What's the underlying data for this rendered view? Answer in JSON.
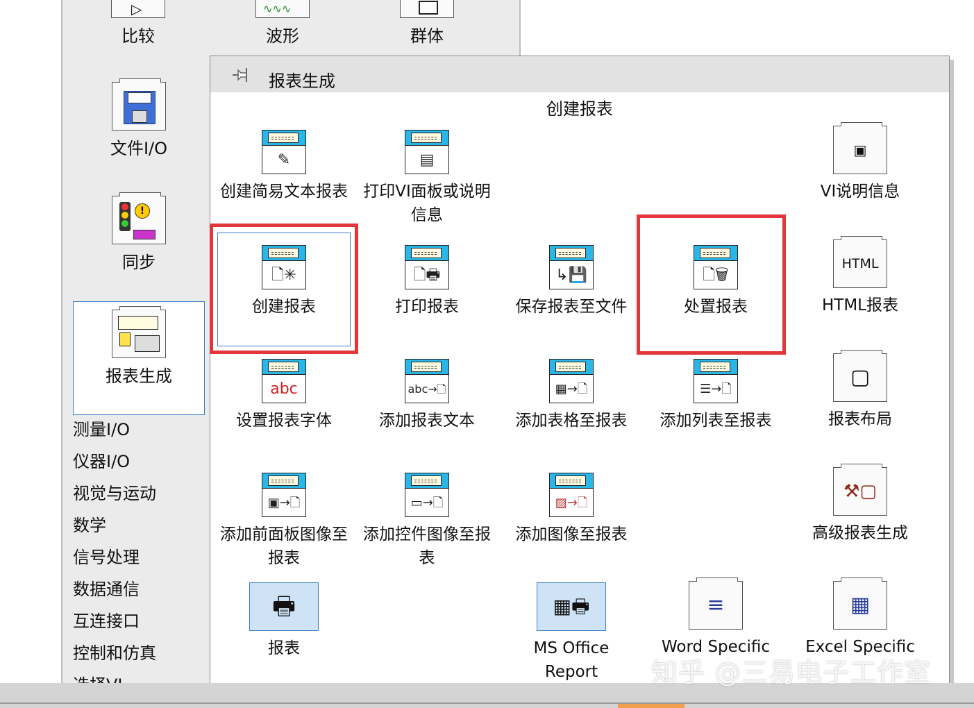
{
  "palette": {
    "top_items": [
      {
        "label": "比较",
        "icon": "compare-icon"
      },
      {
        "label": "波形",
        "icon": "waveform-icon"
      },
      {
        "label": "群体",
        "icon": "cluster-icon"
      }
    ],
    "side_items": [
      {
        "label": "文件I/O",
        "icon": "floppy-disk-icon"
      },
      {
        "label": "同步",
        "icon": "traffic-light-icon"
      },
      {
        "label": "报表生成",
        "icon": "report-printer-icon"
      }
    ],
    "categories": [
      "测量I/O",
      "仪器I/O",
      "视觉与运动",
      "数学",
      "信号处理",
      "数据通信",
      "互连接口",
      "控制和仿真",
      "选择VI..."
    ]
  },
  "submenu": {
    "title": "报表生成",
    "section": "创建报表",
    "tiles": {
      "easy_text_report": {
        "label": "创建简易文本报表",
        "glyph": "✎"
      },
      "print_panel": {
        "label": "打印VI面板或说明信息",
        "glyph": "▤"
      },
      "vi_description": {
        "label": "VI说明信息",
        "glyph": "▣"
      },
      "new_report": {
        "label": "创建报表",
        "glyph": "🗋✳"
      },
      "print_report": {
        "label": "打印报表",
        "glyph": "🗋🖶"
      },
      "save_report": {
        "label": "保存报表至文件",
        "glyph": "↳💾"
      },
      "dispose_report": {
        "label": "处置报表",
        "glyph": "🗋🗑"
      },
      "html_report": {
        "label": "HTML报表",
        "glyph": "HTML"
      },
      "set_font": {
        "label": "设置报表字体",
        "glyph": "abc"
      },
      "append_text": {
        "label": "添加报表文本",
        "glyph": "abc→🗋"
      },
      "append_table": {
        "label": "添加表格至报表",
        "glyph": "▦→🗋"
      },
      "append_list": {
        "label": "添加列表至报表",
        "glyph": "☰→🗋"
      },
      "report_layout": {
        "label": "报表布局",
        "glyph": "▢"
      },
      "append_front_panel": {
        "label": "添加前面板图像至报表",
        "glyph": "▣→🗋"
      },
      "append_control_image": {
        "label": "添加控件图像至报表",
        "glyph": "▭→🗋"
      },
      "append_image": {
        "label": "添加图像至报表",
        "glyph": "▨→🗋"
      },
      "advanced_report": {
        "label": "高级报表生成",
        "glyph": "⚒▢"
      },
      "report_express": {
        "label": "报表",
        "glyph": "🖶"
      },
      "ms_office": {
        "label": "MS Office Report",
        "glyph": "▦🖶"
      },
      "word_specific": {
        "label": "Word Specific",
        "glyph": "≡"
      },
      "excel_specific": {
        "label": "Excel Specific",
        "glyph": "▦"
      }
    }
  },
  "watermark": "知乎 @三易电子工作室",
  "colors": {
    "accent_blue": "#3a7fc4",
    "highlight_red": "#e3363b",
    "report_band": "#29b6e8"
  }
}
